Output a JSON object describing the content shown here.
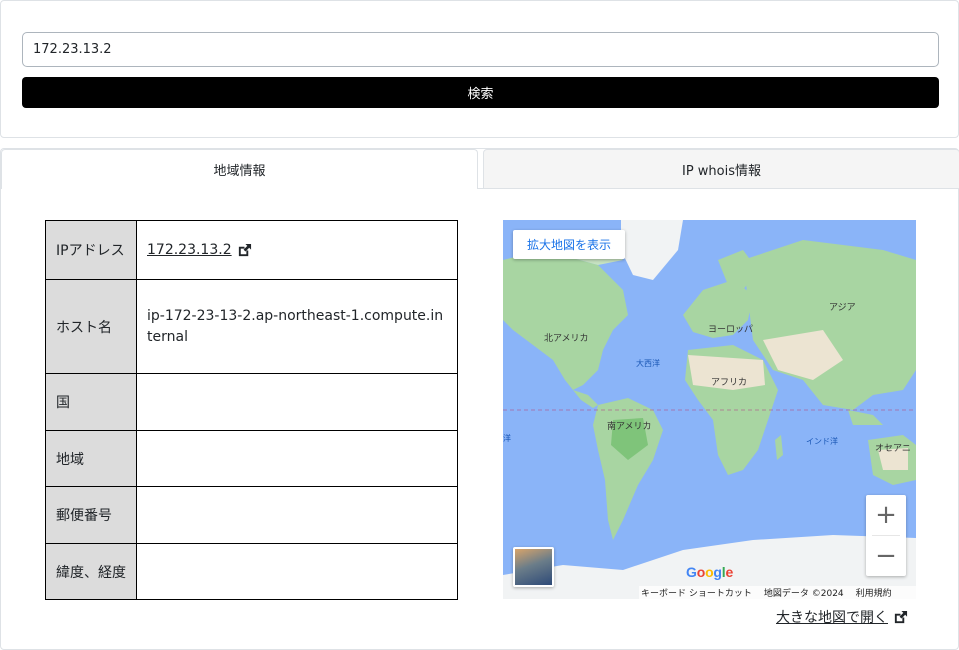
{
  "search": {
    "value": "172.23.13.2",
    "button_label": "検索"
  },
  "tabs": [
    {
      "label": "地域情報",
      "active": true
    },
    {
      "label": "IP whois情報",
      "active": false
    }
  ],
  "info_table": {
    "rows": [
      {
        "label": "IPアドレス",
        "value": "172.23.13.2",
        "link": true
      },
      {
        "label": "ホスト名",
        "value": "ip-172-23-13-2.ap-northeast-1.compute.internal"
      },
      {
        "label": "国",
        "value": ""
      },
      {
        "label": "地域",
        "value": ""
      },
      {
        "label": "郵便番号",
        "value": ""
      },
      {
        "label": "緯度、経度",
        "value": ""
      }
    ]
  },
  "map": {
    "enlarge_label": "拡大地図を表示",
    "zoom_in": "+",
    "zoom_out": "−",
    "labels": {
      "north_america": "北アメリカ",
      "europe": "ヨーロッパ",
      "asia": "アジア",
      "africa": "アフリカ",
      "south_america": "南アメリカ",
      "atlantic": "大西洋",
      "indian_ocean": "インド洋",
      "oceania": "オセアニ",
      "pacific_left": "洋"
    },
    "attribution": {
      "shortcuts": "キーボード ショートカット",
      "data": "地図データ ©2024",
      "terms": "利用規約"
    },
    "google_letters": [
      "G",
      "o",
      "o",
      "g",
      "l",
      "e"
    ],
    "google_colors": [
      "#4285f4",
      "#ea4335",
      "#fbbc05",
      "#4285f4",
      "#34a853",
      "#ea4335"
    ],
    "colors": {
      "ocean": "#8ab4f8",
      "land": "#a8d5a2",
      "desert": "#ece4d2",
      "ice": "#f1f3f4"
    }
  },
  "open_map_link": "大きな地図で開く"
}
